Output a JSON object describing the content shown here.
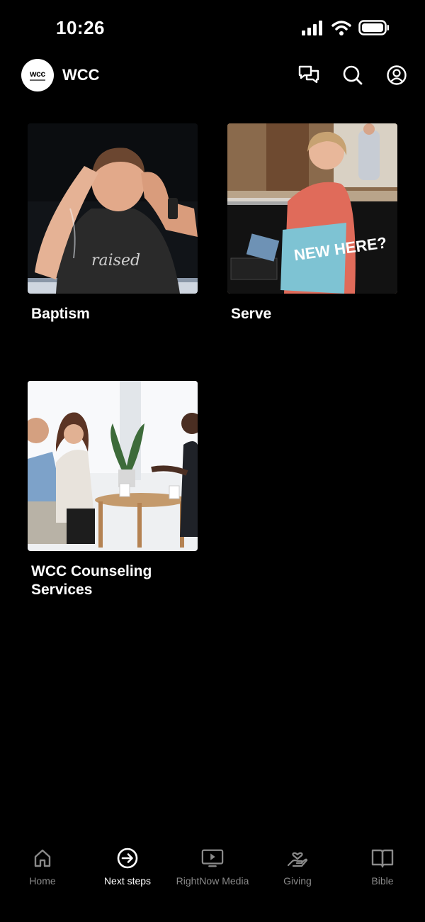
{
  "status_bar": {
    "time": "10:26"
  },
  "header": {
    "logo_text": "wcc",
    "title": "WCC"
  },
  "cards": [
    {
      "title": "Baptism"
    },
    {
      "title": "Serve",
      "sign_text": "NEW HERE?"
    },
    {
      "title": "WCC Counseling Services"
    }
  ],
  "tabs": [
    {
      "label": "Home",
      "icon": "home-icon",
      "active": false
    },
    {
      "label": "Next steps",
      "icon": "arrow-circle-icon",
      "active": true
    },
    {
      "label": "RightNow Media",
      "icon": "tv-play-icon",
      "active": false
    },
    {
      "label": "Giving",
      "icon": "hand-heart-icon",
      "active": false
    },
    {
      "label": "Bible",
      "icon": "book-icon",
      "active": false
    }
  ]
}
